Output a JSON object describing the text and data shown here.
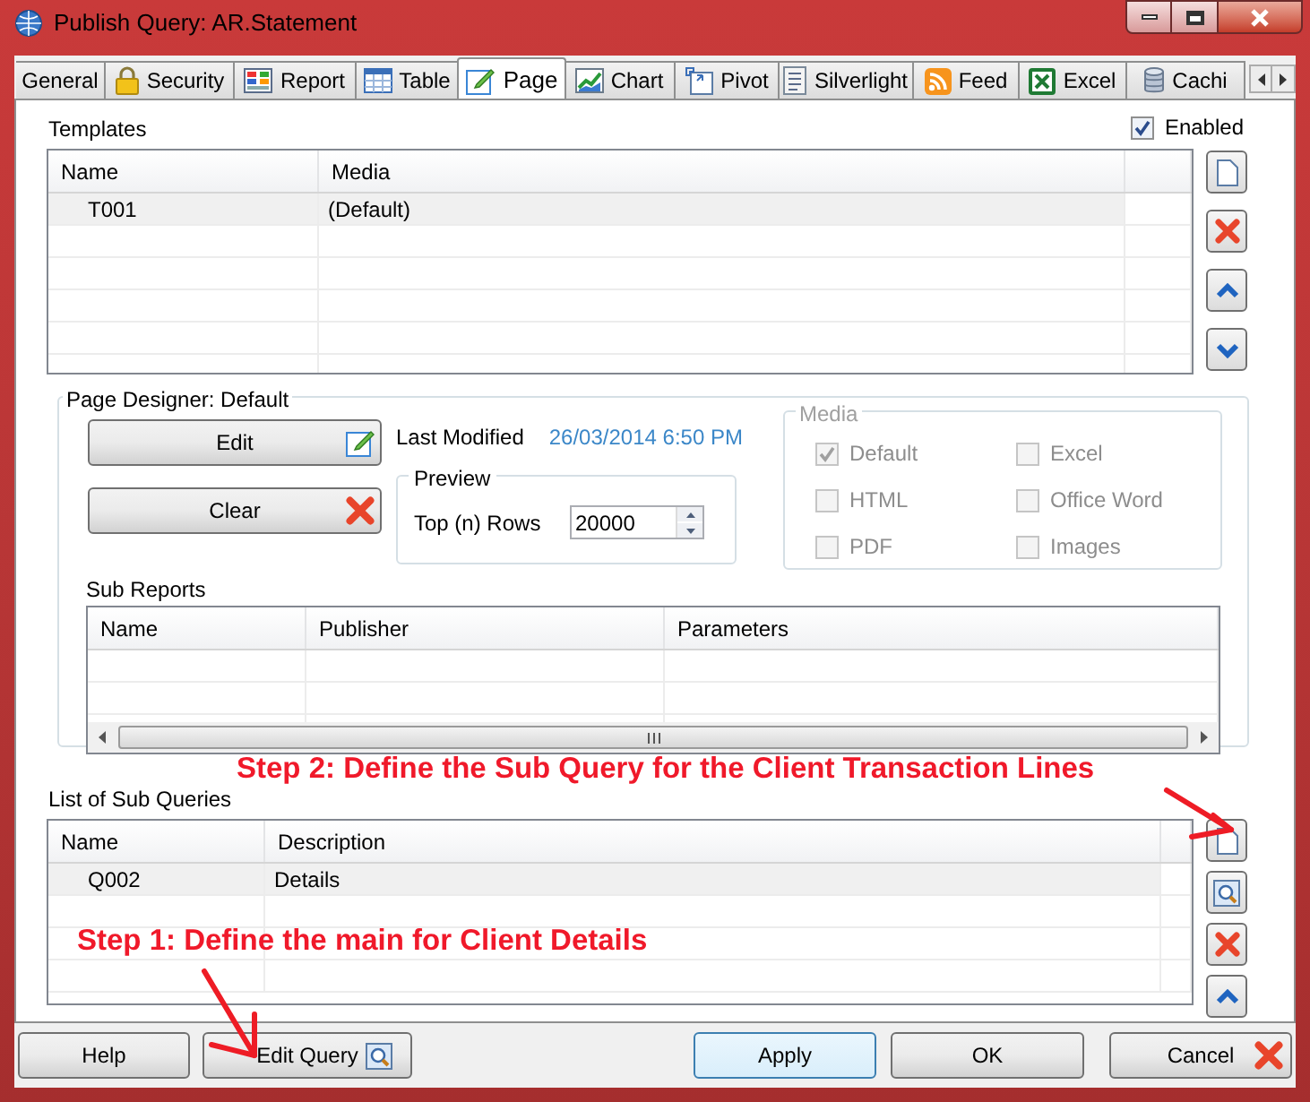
{
  "window": {
    "title": "Publish Query: AR.Statement"
  },
  "tabs": [
    {
      "label": "General",
      "selected": false
    },
    {
      "label": "Security",
      "selected": false
    },
    {
      "label": "Report",
      "selected": false
    },
    {
      "label": "Table",
      "selected": false
    },
    {
      "label": "Page",
      "selected": true
    },
    {
      "label": "Chart",
      "selected": false
    },
    {
      "label": "Pivot",
      "selected": false
    },
    {
      "label": "Silverlight",
      "selected": false
    },
    {
      "label": "Feed",
      "selected": false
    },
    {
      "label": "Excel",
      "selected": false
    },
    {
      "label": "Cachi",
      "selected": false
    }
  ],
  "templates": {
    "label": "Templates",
    "enabled": {
      "label": "Enabled",
      "checked": true
    },
    "columns": [
      "Name",
      "Media"
    ],
    "rows": [
      {
        "name": "T001",
        "media": "(Default)",
        "selected": true
      }
    ]
  },
  "page_designer": {
    "title": "Page Designer: Default",
    "buttons": [
      {
        "label": "Edit",
        "kind": "edit"
      },
      {
        "label": "Clear",
        "kind": "clear"
      }
    ],
    "last_modified_label": "Last Modified",
    "last_modified": "26/03/2014 6:50 PM",
    "preview": {
      "title": "Preview",
      "label": "Top (n) Rows",
      "value": "20000"
    },
    "media": {
      "title": "Media",
      "disabled": true,
      "options": [
        {
          "label": "Default",
          "checked": true
        },
        {
          "label": "Excel",
          "checked": false
        },
        {
          "label": "HTML",
          "checked": false
        },
        {
          "label": "Office Word",
          "checked": false
        },
        {
          "label": "PDF",
          "checked": false
        },
        {
          "label": "Images",
          "checked": false
        }
      ]
    },
    "sub_reports": {
      "label": "Sub Reports",
      "columns": [
        "Name",
        "Publisher",
        "Parameters"
      ]
    }
  },
  "sub_queries": {
    "label": "List of Sub Queries",
    "columns": [
      "Name",
      "Description"
    ],
    "rows": [
      {
        "name": "Q002",
        "description": "Details",
        "selected": true
      }
    ]
  },
  "annotations": [
    {
      "text": "Step 2: Define the Sub Query for the Client Transaction Lines"
    },
    {
      "text": "Step 1: Define the main for Client Details"
    }
  ],
  "buttons": [
    {
      "label": "Help",
      "kind": "plain"
    },
    {
      "label": "Edit Query",
      "kind": "query"
    },
    {
      "label": "Apply",
      "kind": "default"
    },
    {
      "label": "OK",
      "kind": "plain"
    },
    {
      "label": "Cancel",
      "kind": "cancel"
    }
  ]
}
